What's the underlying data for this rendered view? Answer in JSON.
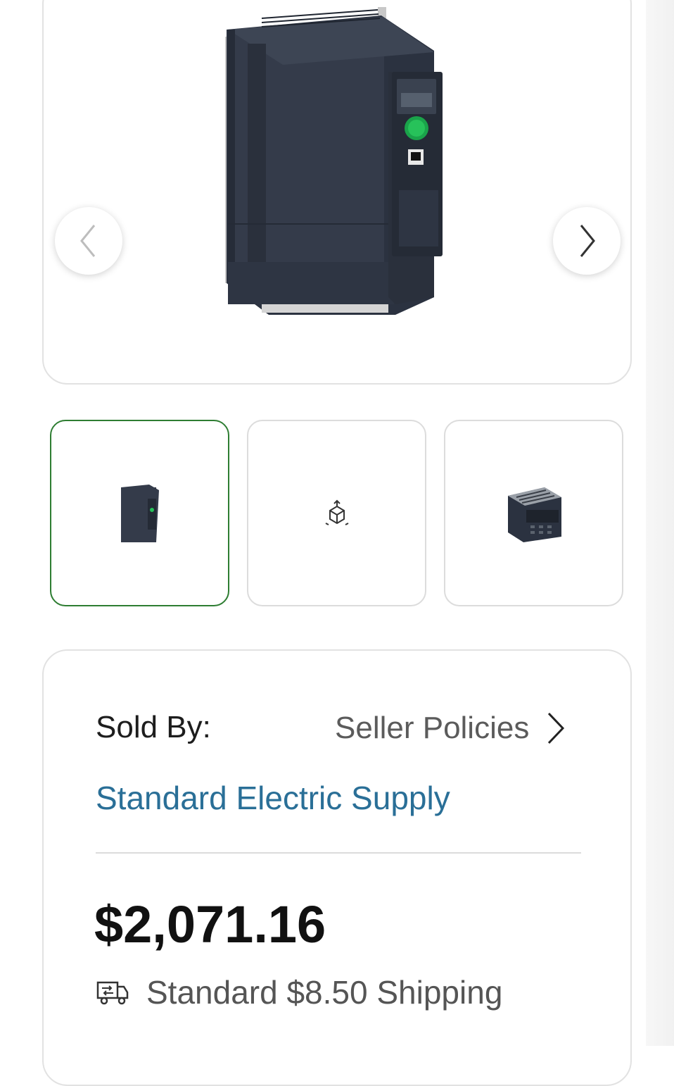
{
  "gallery": {
    "main_image_icon": "variable-speed-drive-product-image",
    "prev_icon": "chevron-left-icon",
    "next_icon": "chevron-right-icon",
    "thumbnails": [
      {
        "icon": "drive-front-thumbnail",
        "selected": true
      },
      {
        "icon": "3d-view-icon",
        "selected": false
      },
      {
        "icon": "drive-top-thumbnail",
        "selected": false
      }
    ]
  },
  "seller": {
    "sold_by_label": "Sold By:",
    "policies_label": "Seller Policies",
    "name": "Standard Electric Supply"
  },
  "pricing": {
    "price": "$2,071.16",
    "shipping": "Standard $8.50 Shipping",
    "shipping_icon": "delivery-truck-icon"
  },
  "colors": {
    "selected_border": "#2e7d32",
    "seller_link": "#2a6f97"
  }
}
